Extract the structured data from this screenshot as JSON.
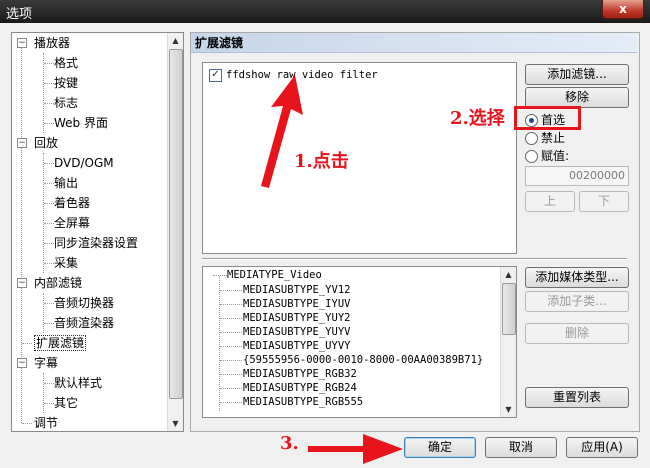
{
  "window": {
    "title": "选项",
    "close_label": "x"
  },
  "sidebar": {
    "items": [
      {
        "label": "播放器"
      },
      {
        "label": "格式"
      },
      {
        "label": "按键"
      },
      {
        "label": "标志"
      },
      {
        "label": "Web 界面"
      },
      {
        "label": "回放"
      },
      {
        "label": "DVD/OGM"
      },
      {
        "label": "输出"
      },
      {
        "label": "着色器"
      },
      {
        "label": "全屏幕"
      },
      {
        "label": "同步渲染器设置"
      },
      {
        "label": "采集"
      },
      {
        "label": "内部滤镜"
      },
      {
        "label": "音频切换器"
      },
      {
        "label": "音频渲染器"
      },
      {
        "label": "扩展滤镜"
      },
      {
        "label": "字幕"
      },
      {
        "label": "默认样式"
      },
      {
        "label": "其它"
      },
      {
        "label": "调节"
      }
    ],
    "selected": "扩展滤镜"
  },
  "panel": {
    "title": "扩展滤镜",
    "filters": [
      {
        "label": "ffdshow raw video filter",
        "checked": true
      }
    ],
    "buttons": {
      "add_filter": "添加滤镜...",
      "remove": "移除",
      "up": "上",
      "down": "下",
      "add_media_type": "添加媒体类型...",
      "add_subtype": "添加子类...",
      "delete": "删除",
      "reset_list": "重置列表"
    },
    "priority": {
      "options": [
        {
          "label": "首选",
          "selected": true
        },
        {
          "label": "禁止",
          "selected": false
        },
        {
          "label": "赋值:",
          "selected": false
        }
      ],
      "merit_value": "00200000"
    },
    "media_types": {
      "root": "MEDIATYPE_Video",
      "subtypes": [
        "MEDIASUBTYPE_YV12",
        "MEDIASUBTYPE_IYUV",
        "MEDIASUBTYPE_YUY2",
        "MEDIASUBTYPE_YUYV",
        "MEDIASUBTYPE_UYVY",
        "{59555956-0000-0010-8000-00AA00389B71}",
        "MEDIASUBTYPE_RGB32",
        "MEDIASUBTYPE_RGB24",
        "MEDIASUBTYPE_RGB555"
      ]
    }
  },
  "footer": {
    "ok": "确定",
    "cancel": "取消",
    "apply": "应用(A)"
  },
  "annotations": {
    "step1": "1.点击",
    "step2": "2.选择",
    "step3": "3.",
    "color": "#e8141c"
  }
}
